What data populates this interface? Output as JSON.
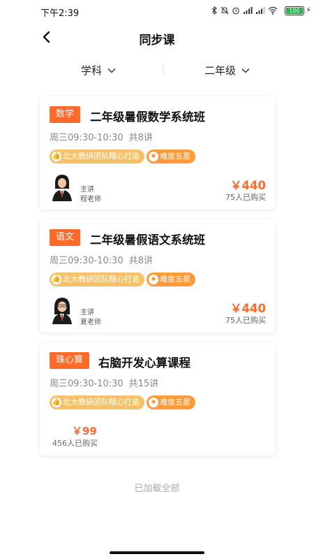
{
  "status": {
    "time": "下午2:39",
    "battery": "100"
  },
  "header": {
    "title": "同步课"
  },
  "filters": [
    {
      "label": "学科"
    },
    {
      "label": "二年级"
    }
  ],
  "courses": [
    {
      "subject": "数学",
      "title": "二年级暑假数学系统班",
      "time": "周三09:30-10:30",
      "lessons": "共8讲",
      "tags": [
        "北大教研团队精心打造",
        "难度五星"
      ],
      "teacher_role": "主讲",
      "teacher_name": "程老师",
      "price": "￥440",
      "bought": "75人已购买"
    },
    {
      "subject": "语文",
      "title": "二年级暑假语文系统班",
      "time": "周三09:30-10:30",
      "lessons": "共8讲",
      "tags": [
        "北大教研团队精心打造",
        "难度五星"
      ],
      "teacher_role": "主讲",
      "teacher_name": "夏老师",
      "price": "￥440",
      "bought": "75人已购买"
    },
    {
      "subject": "珠心算",
      "title": "右脑开发心算课程",
      "time": "周三09:30-10:30",
      "lessons": "共15讲",
      "tags": [
        "北大教研团队精心打造",
        "难度五星"
      ],
      "price": "￥99",
      "bought": "456人已购买"
    }
  ],
  "footer": {
    "loaded_text": "已加载全部"
  },
  "colors": {
    "accent": "#ff6a2b",
    "tag_team": "#f5c26b",
    "tag_level": "#ff9a3c"
  }
}
